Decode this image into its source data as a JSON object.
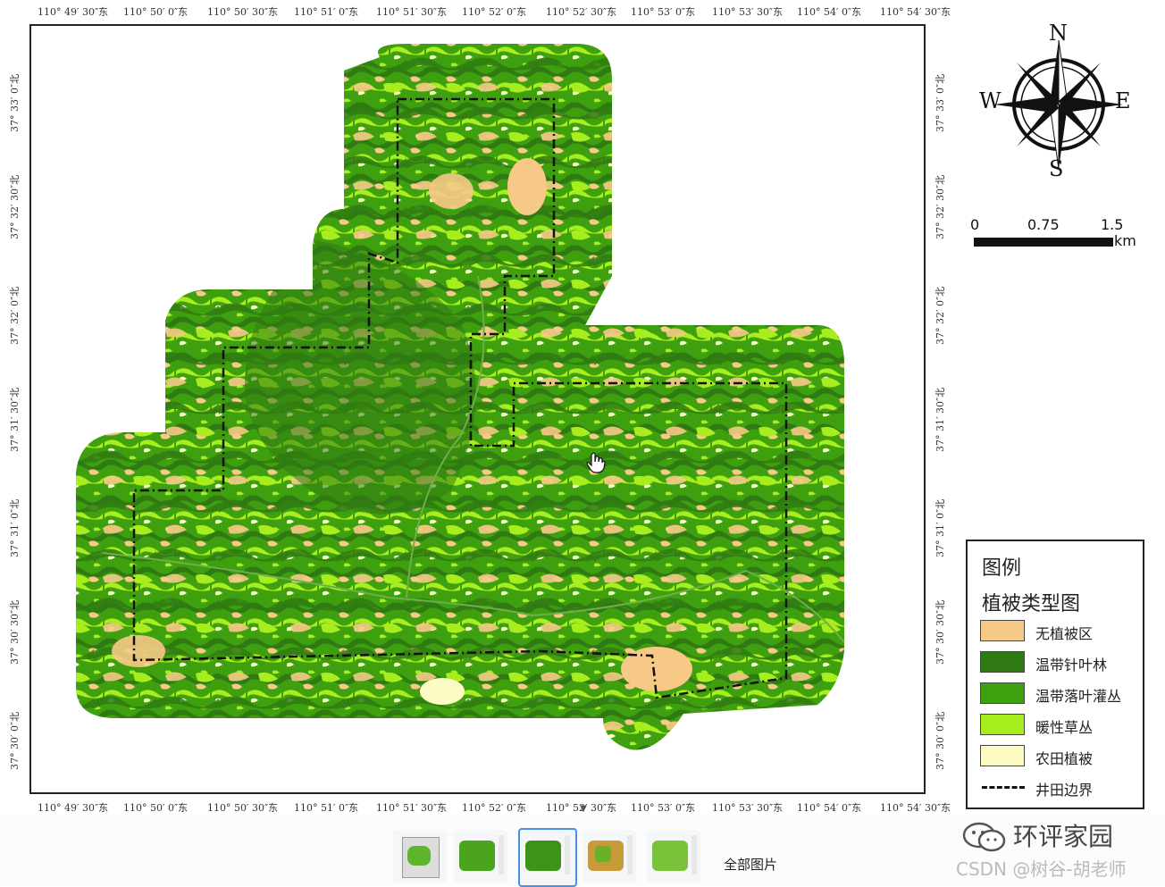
{
  "map": {
    "top_ticks": [
      "110° 49′ 30″东",
      "110° 50′ 0″东",
      "110° 50′ 30″东",
      "110° 51′ 0″东",
      "110° 51′ 30″东",
      "110° 52′ 0″东",
      "110° 52′ 30″东",
      "110° 53′ 0″东",
      "110° 53′ 30″东",
      "110° 54′ 0″东",
      "110° 54′ 30″东"
    ],
    "bottom_ticks": [
      "110° 49′ 30″东",
      "110° 50′ 0″东",
      "110° 50′ 30″东",
      "110° 51′ 0″东",
      "110° 51′ 30″东",
      "110° 52′ 0″东",
      "110° 52′ 30″东",
      "110° 53′ 0″东",
      "110° 53′ 30″东",
      "110° 54′ 0″东",
      "110° 54′ 30″东"
    ],
    "left_ticks": [
      "37° 33′ 0″北",
      "37° 32′ 30″北",
      "37° 32′ 0″北",
      "37° 31′ 30″北",
      "37° 31′ 0″北",
      "37° 30′ 30″北",
      "37° 30′ 0″北"
    ],
    "right_ticks": [
      "37° 33′ 0″北",
      "37° 32′ 30″北",
      "37° 32′ 0″北",
      "37° 31′ 30″北",
      "37° 31′ 0″北",
      "37° 30′ 30″北",
      "37° 30′ 0″北"
    ]
  },
  "compass": {
    "n": "N",
    "s": "S",
    "e": "E",
    "w": "W"
  },
  "scalebar": {
    "labels": [
      "0",
      "0.75",
      "1.5"
    ],
    "unit": "km"
  },
  "legend": {
    "title": "图例",
    "subtitle": "植被类型图",
    "items": [
      {
        "label": "无植被区",
        "color": "#f6c987"
      },
      {
        "label": "温带针叶林",
        "color": "#2f7a12"
      },
      {
        "label": "温带落叶灌丛",
        "color": "#3fa00f"
      },
      {
        "label": "暖性草丛",
        "color": "#a8ee1e"
      },
      {
        "label": "农田植被",
        "color": "#fdfbc4"
      },
      {
        "label": "井田边界",
        "style": "dash-dot"
      }
    ]
  },
  "thumbnail_bar": {
    "all_images_label": "全部图片",
    "collapse_icon": "chevron-down-icon"
  },
  "watermark": {
    "brand": "环评家园",
    "credit": "CSDN @树谷-胡老师"
  }
}
